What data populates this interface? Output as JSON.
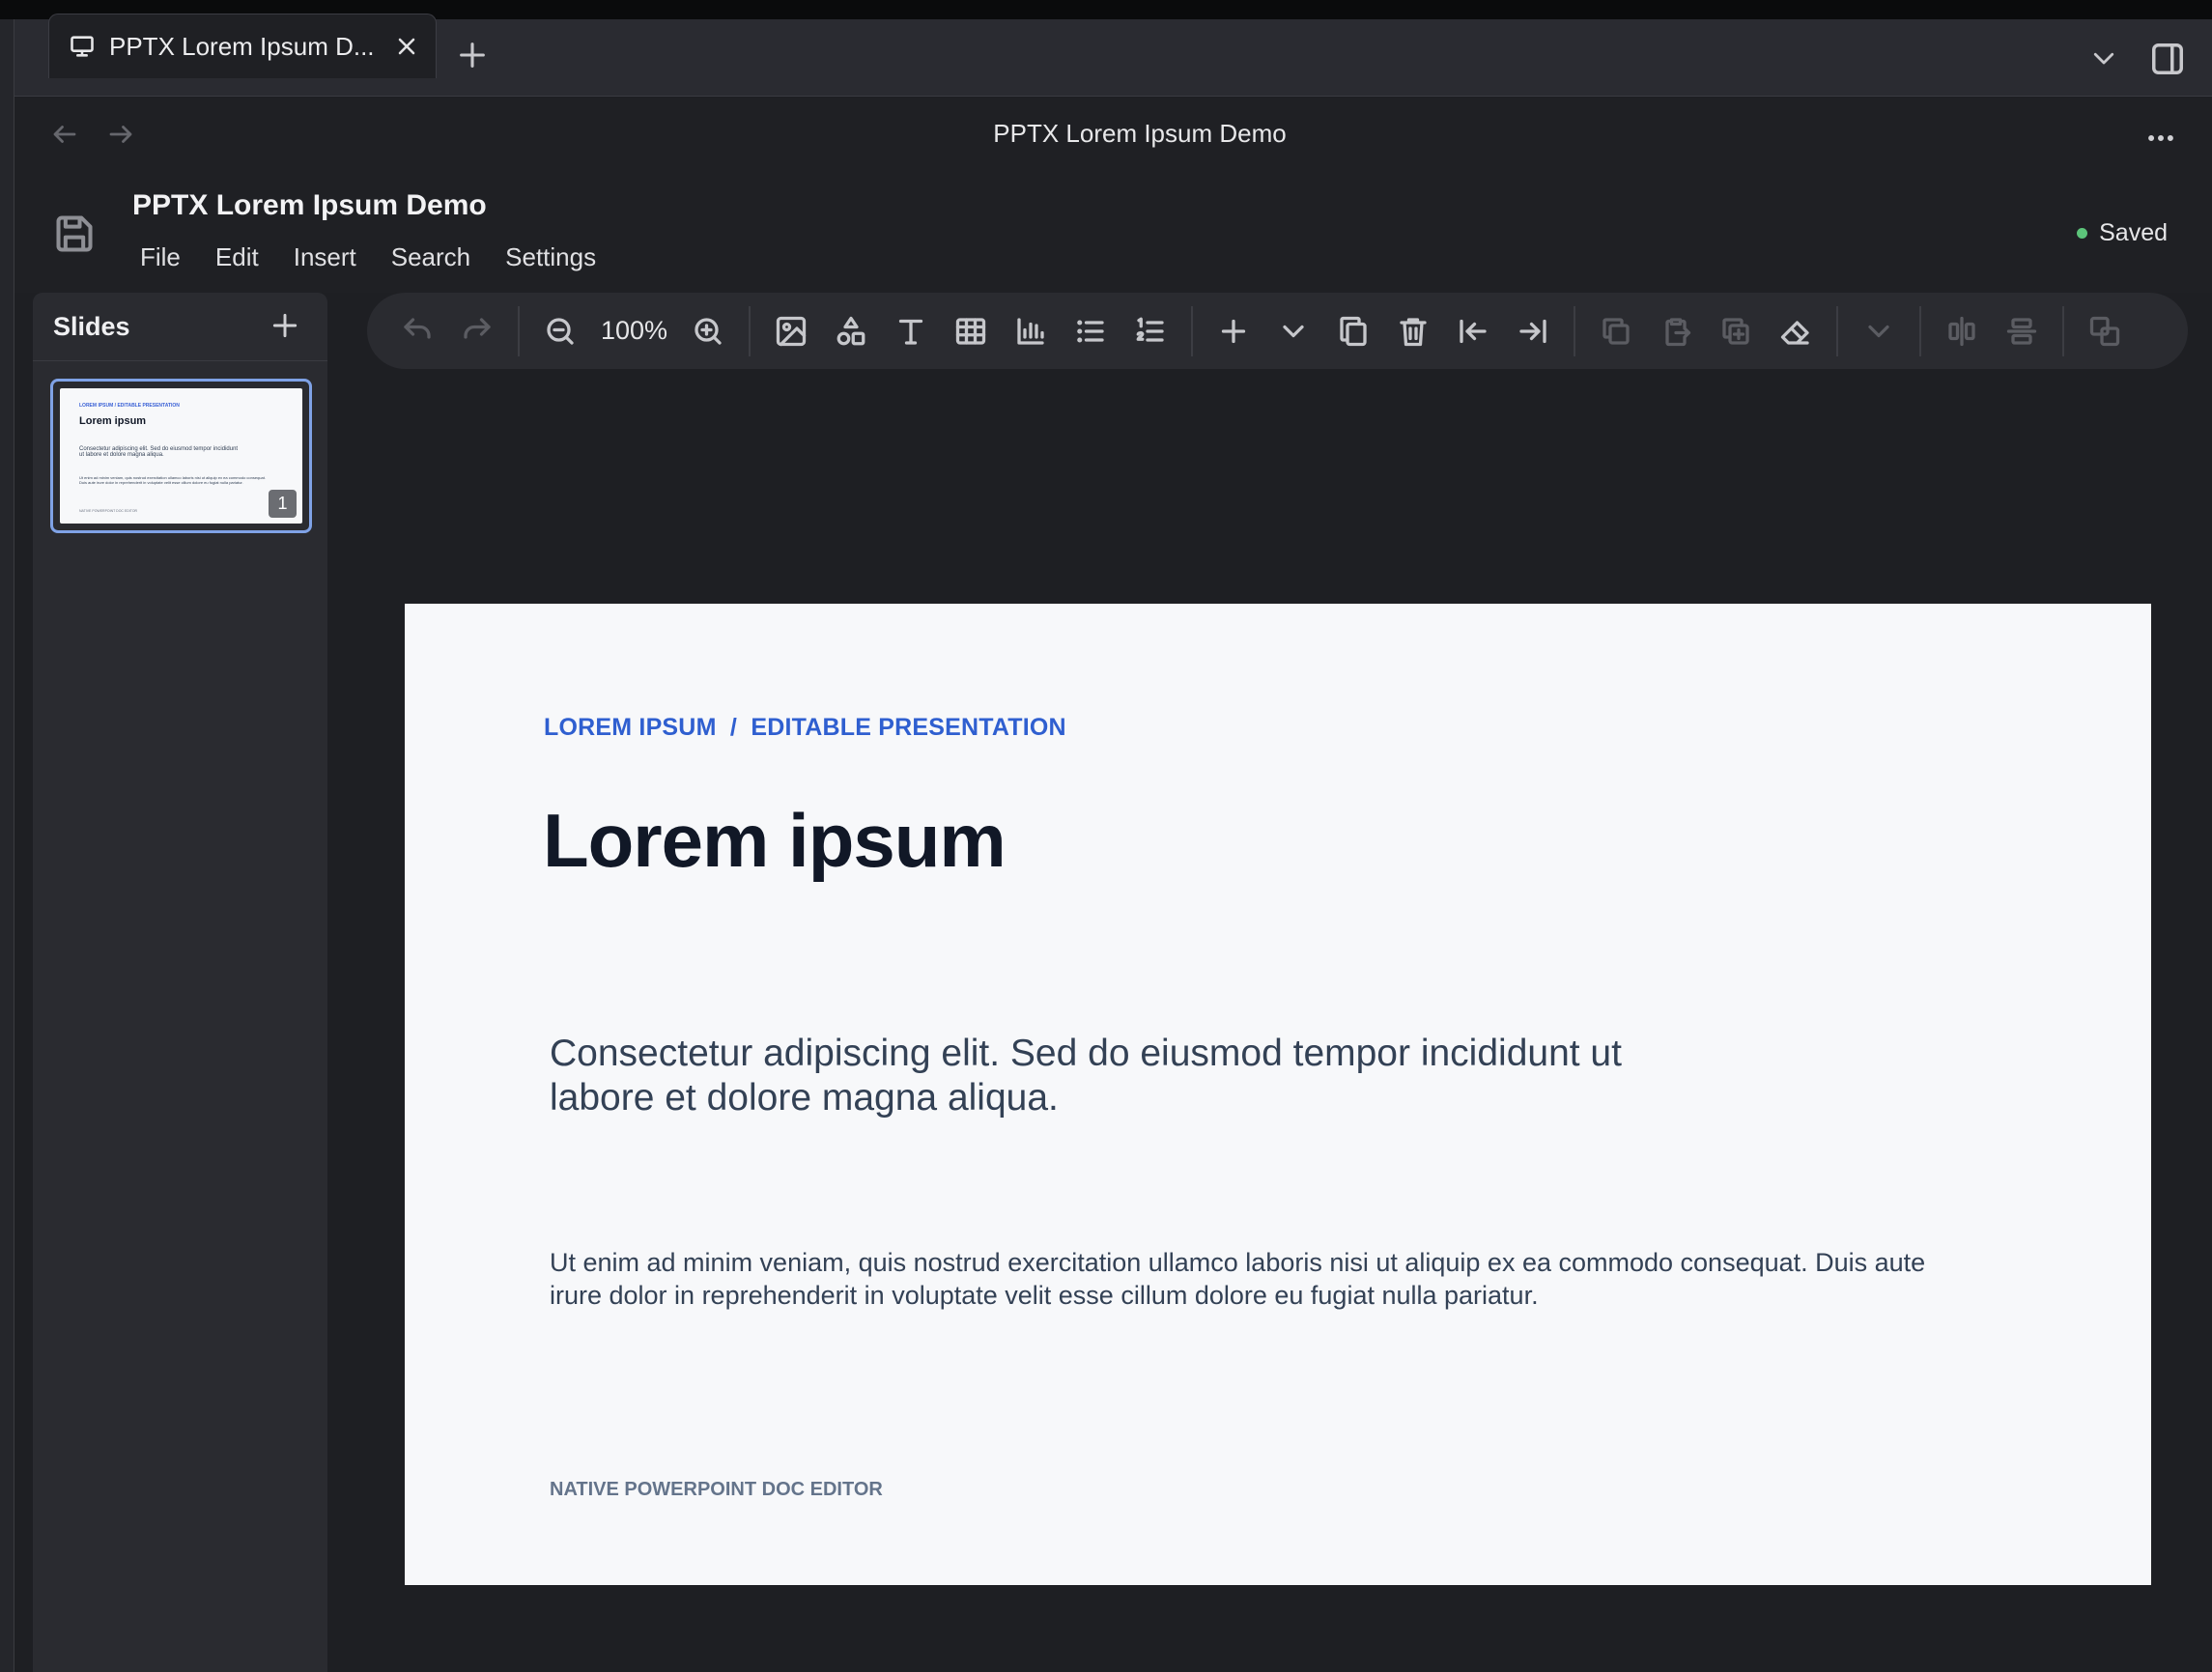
{
  "browser": {
    "tab_title": "PPTX Lorem Ipsum D...",
    "page_title": "PPTX Lorem Ipsum Demo"
  },
  "app": {
    "doc_title": "PPTX Lorem Ipsum Demo",
    "menu": [
      "File",
      "Edit",
      "Insert",
      "Search",
      "Settings"
    ],
    "status": "Saved",
    "status_color": "#5cc47a"
  },
  "sidebar": {
    "title": "Slides",
    "slides": [
      {
        "number": "1",
        "selected": true
      }
    ]
  },
  "toolbar": {
    "zoom": "100%",
    "icons": [
      "undo-icon",
      "redo-icon",
      "zoom-out-icon",
      "zoom-in-icon",
      "image-icon",
      "shapes-icon",
      "text-icon",
      "table-icon",
      "chart-icon",
      "bullet-list-icon",
      "numbered-list-icon",
      "add-icon",
      "chevron-down-icon",
      "duplicate-icon",
      "delete-icon",
      "move-first-icon",
      "move-last-icon",
      "copy-icon",
      "paste-icon",
      "clone-icon",
      "eraser-icon",
      "dropdown-icon",
      "align-center-icon",
      "distribute-icon",
      "group-icon"
    ]
  },
  "slide": {
    "kicker": "LOREM IPSUM  /  EDITABLE PRESENTATION",
    "title": "Lorem ipsum",
    "lead": "Consectetur adipiscing elit. Sed do eiusmod tempor incididunt ut labore et dolore magna aliqua.",
    "body": "Ut enim ad minim veniam, quis nostrud exercitation ullamco laboris nisi ut aliquip ex ea commodo consequat. Duis aute irure dolor in reprehenderit in voluptate velit esse cillum dolore eu fugiat nulla pariatur.",
    "footer": "NATIVE POWERPOINT DOC EDITOR",
    "accent_color": "#2f5fd0"
  }
}
